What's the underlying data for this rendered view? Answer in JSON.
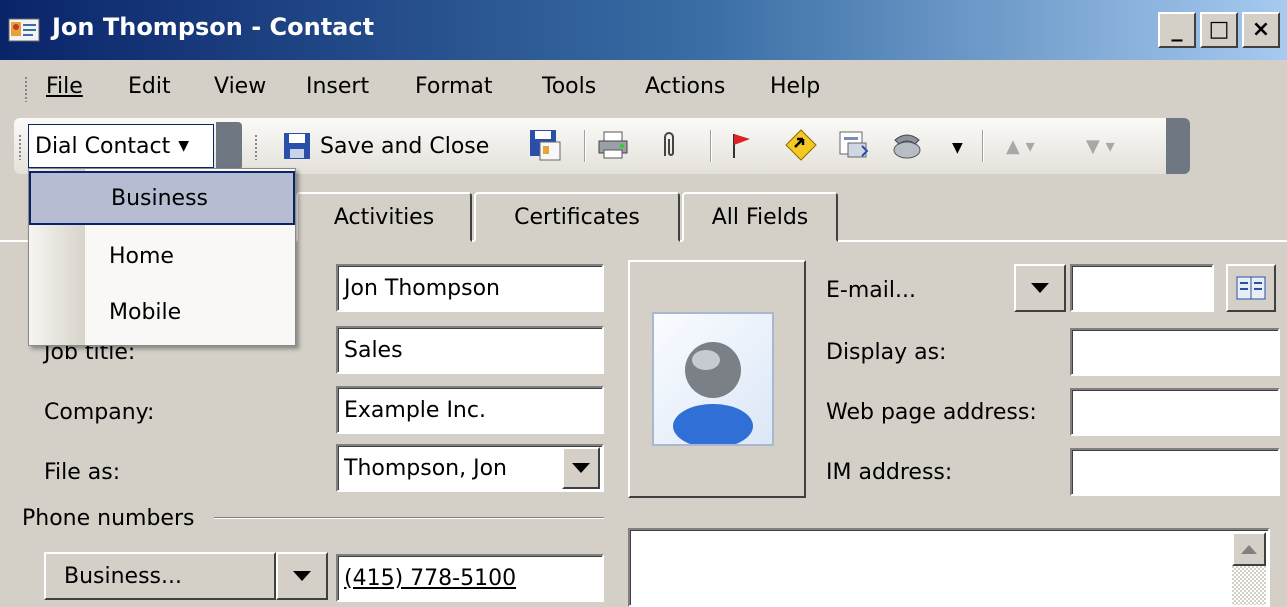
{
  "window": {
    "title": "Jon Thompson - Contact",
    "controls": [
      "_",
      "□",
      "×"
    ]
  },
  "menu": [
    "File",
    "Edit",
    "View",
    "Insert",
    "Format",
    "Tools",
    "Actions",
    "Help"
  ],
  "toolbar": {
    "dial_contact": "Dial Contact",
    "save_close": "Save and Close"
  },
  "tabs": [
    "Activities",
    "Certificates",
    "All Fields"
  ],
  "dropdown": {
    "items": [
      "Business",
      "Home",
      "Mobile"
    ],
    "selected": "Business"
  },
  "form": {
    "full_name_value": "Jon Thompson",
    "job_title_label": "Job title:",
    "job_title_value": "Sales",
    "company_label": "Company:",
    "company_value": "Example Inc.",
    "file_as_label": "File as:",
    "file_as_value": "Thompson, Jon",
    "email_label": "E-mail...",
    "display_as_label": "Display as:",
    "web_label": "Web page address:",
    "im_label": "IM address:",
    "phone_group_label": "Phone numbers",
    "phone_type": "Business...",
    "phone_value": "(415) 778-5100"
  },
  "colors": {
    "titlebar_start": "#0a246a",
    "dropdown_selected": "#b6bdd2",
    "face": "#d4d0c8"
  }
}
